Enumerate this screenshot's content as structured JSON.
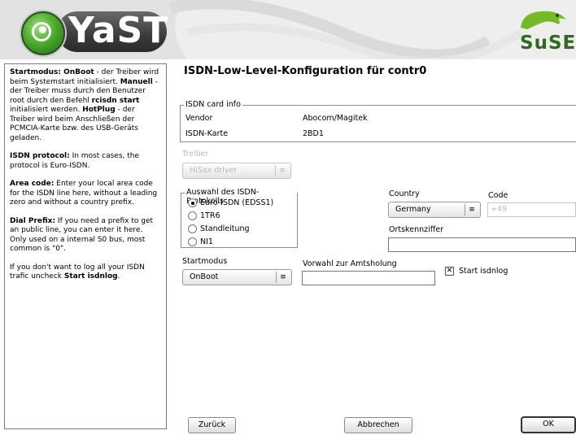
{
  "header": {
    "logo_text": "YaST",
    "brand_text": "SuSE"
  },
  "help": {
    "p1": [
      {
        "t": "Startmodus: OnBoot",
        "b": true
      },
      {
        "t": " - der Treiber wird beim Systemstart initialisiert. ",
        "b": false
      },
      {
        "t": "Manuell",
        "b": true
      },
      {
        "t": " - der Treiber muss durch den Benutzer root durch den Befehl ",
        "b": false
      },
      {
        "t": "rcisdn start",
        "b": true
      },
      {
        "t": " initialisiert werden. ",
        "b": false
      },
      {
        "t": "HotPlug",
        "b": true
      },
      {
        "t": " - der Treiber wird beim Anschließen der PCMCIA-Karte bzw. des USB-Geräts geladen.",
        "b": false
      }
    ],
    "p2": [
      {
        "t": "ISDN protocol:",
        "b": true
      },
      {
        "t": " In most cases, the protocol is Euro-ISDN.",
        "b": false
      }
    ],
    "p3": [
      {
        "t": "Area code:",
        "b": true
      },
      {
        "t": " Enter your local area code for the ISDN line here, without a leading zero and without a country prefix.",
        "b": false
      }
    ],
    "p4": [
      {
        "t": "Dial Prefix:",
        "b": true
      },
      {
        "t": " If you need a prefix to get an public line, you can enter it here. Only used on a internal S0 bus, most common is \"0\".",
        "b": false
      }
    ],
    "p5": [
      {
        "t": "If you don't want to log all your ISDN trafic uncheck ",
        "b": false
      },
      {
        "t": "Start isdnlog",
        "b": true
      },
      {
        "t": ".",
        "b": false
      }
    ]
  },
  "main": {
    "title": "ISDN-Low-Level-Konfiguration für contr0",
    "card_info": {
      "legend": "ISDN card info",
      "vendor_label": "Vendor",
      "vendor_value": "Abocom/Magitek",
      "card_label": "ISDN-Karte",
      "card_value": "2BD1"
    },
    "driver": {
      "label": "Treiber",
      "value": "HiSax driver"
    },
    "protocol": {
      "legend": "Auswahl des ISDN-Protokolls",
      "options": [
        "Euro-ISDN (EDSS1)",
        "1TR6",
        "Standleitung",
        "NI1"
      ],
      "selected_index": 0
    },
    "country": {
      "label": "Country",
      "value": "Germany"
    },
    "code": {
      "label": "Code",
      "value": "+49"
    },
    "area_code": {
      "label": "Ortskennziffer",
      "value": ""
    },
    "startmode": {
      "label": "Startmodus",
      "value": "OnBoot"
    },
    "dial_prefix": {
      "label": "Vorwahl zur Amtsholung",
      "value": ""
    },
    "isdnlog": {
      "label": "Start isdnlog",
      "checked": true
    }
  },
  "buttons": {
    "back": "Zurück",
    "cancel": "Abbrechen",
    "ok": "OK"
  }
}
